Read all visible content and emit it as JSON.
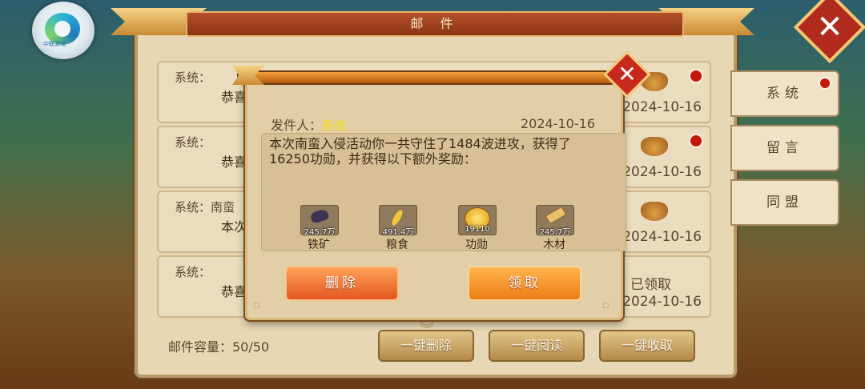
{
  "panel": {
    "title": "邮 件"
  },
  "mails": [
    {
      "sender": "系统：",
      "preview": "恭喜",
      "date": "2024-10-16",
      "status": "",
      "has_reward": true,
      "unread": true
    },
    {
      "sender": "系统：",
      "preview": "恭喜",
      "date": "2024-10-16",
      "status": "",
      "has_reward": true,
      "unread": true
    },
    {
      "sender": "系统：南蛮",
      "preview": "本次",
      "date": "2024-10-16",
      "status": "",
      "has_reward": true,
      "unread": false
    },
    {
      "sender": "系统：",
      "preview": "恭喜",
      "date": "2024-10-16",
      "status": "已领取",
      "has_reward": false,
      "unread": false
    }
  ],
  "tabs": [
    {
      "label": "系统",
      "unread": true
    },
    {
      "label": "留言",
      "unread": false
    },
    {
      "label": "同盟",
      "unread": false
    }
  ],
  "capacity": "邮件容量：50/50",
  "bottom_buttons": {
    "delete_all": "一键删除",
    "read_all": "一键阅读",
    "claim_all": "一键收取"
  },
  "dialog": {
    "sender_label": "发件人：",
    "sender_name": "系统",
    "date": "2024-10-16",
    "content": "本次南蛮入侵活动你一共守住了1484波进攻，获得了16250功勋，并获得以下额外奖励：",
    "rewards": [
      {
        "name": "铁矿",
        "amount": "245.7万",
        "icon": "iron-ore-icon"
      },
      {
        "name": "粮食",
        "amount": "491.4万",
        "icon": "grain-icon"
      },
      {
        "name": "功勋",
        "amount": "19110",
        "icon": "merit-coin-icon"
      },
      {
        "name": "木材",
        "amount": "245.7万",
        "icon": "wood-icon"
      }
    ],
    "delete_label": "删除",
    "claim_label": "领取"
  },
  "logo_text": "中联游戏",
  "colors": {
    "accent": "#ee7d16",
    "panel": "#e8d7b5",
    "unread": "#c4180c"
  }
}
